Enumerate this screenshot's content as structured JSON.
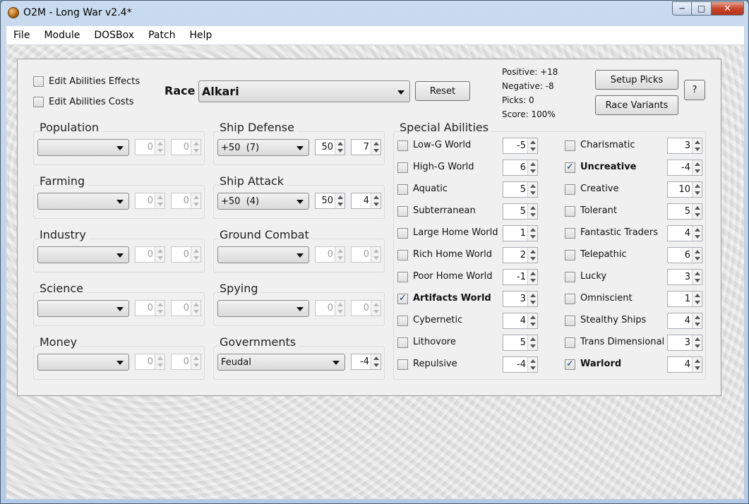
{
  "window": {
    "title": "O2M - Long War v2.4*"
  },
  "menu": [
    "File",
    "Module",
    "DOSBox",
    "Patch",
    "Help"
  ],
  "options": {
    "edit_effects": "Edit Abilities Effects",
    "edit_costs": "Edit Abilities Costs"
  },
  "race": {
    "label": "Race",
    "value": "Alkari",
    "reset": "Reset"
  },
  "stats": {
    "positive": "Positive: +18",
    "negative": "Negative: -8",
    "picks": "Picks: 0",
    "score": "Score: 100%"
  },
  "buttons": {
    "setup_picks": "Setup Picks",
    "race_variants": "Race Variants",
    "help": "?"
  },
  "groups": [
    {
      "title": "Population",
      "combo": "",
      "v1": "0",
      "v2": "0"
    },
    {
      "title": "Farming",
      "combo": "",
      "v1": "0",
      "v2": "0"
    },
    {
      "title": "Industry",
      "combo": "",
      "v1": "0",
      "v2": "0"
    },
    {
      "title": "Science",
      "combo": "",
      "v1": "0",
      "v2": "0"
    },
    {
      "title": "Money",
      "combo": "",
      "v1": "0",
      "v2": "0"
    },
    {
      "title": "Ship Defense",
      "combo": "+50  (7)",
      "v1": "50",
      "v2": "7"
    },
    {
      "title": "Ship Attack",
      "combo": "+50  (4)",
      "v1": "50",
      "v2": "4"
    },
    {
      "title": "Ground Combat",
      "combo": "",
      "v1": "0",
      "v2": "0"
    },
    {
      "title": "Spying",
      "combo": "",
      "v1": "0",
      "v2": "0"
    }
  ],
  "governments": {
    "title": "Governments",
    "combo": "Feudal",
    "v": "-4"
  },
  "special": {
    "title": "Special Abilities",
    "left": [
      {
        "name": "Low-G World",
        "value": "-5",
        "checked": false
      },
      {
        "name": "High-G World",
        "value": "6",
        "checked": false
      },
      {
        "name": "Aquatic",
        "value": "5",
        "checked": false
      },
      {
        "name": "Subterranean",
        "value": "5",
        "checked": false
      },
      {
        "name": "Large Home World",
        "value": "1",
        "checked": false
      },
      {
        "name": "Rich Home World",
        "value": "2",
        "checked": false
      },
      {
        "name": "Poor Home World",
        "value": "-1",
        "checked": false
      },
      {
        "name": "Artifacts World",
        "value": "3",
        "checked": true
      },
      {
        "name": "Cybernetic",
        "value": "4",
        "checked": false
      },
      {
        "name": "Lithovore",
        "value": "5",
        "checked": false
      },
      {
        "name": "Repulsive",
        "value": "-4",
        "checked": false
      }
    ],
    "right": [
      {
        "name": "Charismatic",
        "value": "3",
        "checked": false
      },
      {
        "name": "Uncreative",
        "value": "-4",
        "checked": true
      },
      {
        "name": "Creative",
        "value": "10",
        "checked": false
      },
      {
        "name": "Tolerant",
        "value": "5",
        "checked": false
      },
      {
        "name": "Fantastic Traders",
        "value": "4",
        "checked": false
      },
      {
        "name": "Telepathic",
        "value": "6",
        "checked": false
      },
      {
        "name": "Lucky",
        "value": "3",
        "checked": false
      },
      {
        "name": "Omniscient",
        "value": "1",
        "checked": false
      },
      {
        "name": "Stealthy Ships",
        "value": "4",
        "checked": false
      },
      {
        "name": "Trans Dimensional",
        "value": "3",
        "checked": false
      },
      {
        "name": "Warlord",
        "value": "4",
        "checked": true
      }
    ]
  }
}
